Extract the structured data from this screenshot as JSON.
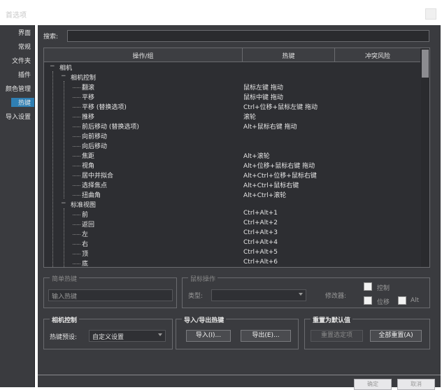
{
  "window": {
    "title": "首选项"
  },
  "sidebar": {
    "items": [
      "界面",
      "常规",
      "文件夹",
      "插件",
      "颜色管理",
      "热键",
      "导入设置"
    ],
    "selected_index": 5
  },
  "search": {
    "label": "搜索:",
    "value": ""
  },
  "table": {
    "headers": [
      "操作/组",
      "热键",
      "冲突风险"
    ],
    "rows": [
      {
        "depth": 0,
        "toggle": "−",
        "name": "相机",
        "key": ""
      },
      {
        "depth": 1,
        "toggle": "−",
        "name": "相机控制",
        "key": ""
      },
      {
        "depth": 2,
        "toggle": "",
        "name": "翻滚",
        "key": "鼠标左键 拖动"
      },
      {
        "depth": 2,
        "toggle": "",
        "name": "平移",
        "key": "鼠标中键 拖动"
      },
      {
        "depth": 2,
        "toggle": "",
        "name": "平移 (替换选项)",
        "key": "Ctrl+位移+鼠标左键 拖动"
      },
      {
        "depth": 2,
        "toggle": "",
        "name": "推移",
        "key": "滚轮"
      },
      {
        "depth": 2,
        "toggle": "",
        "name": "前后移动 (替换选项)",
        "key": "Alt+鼠标右键 拖动"
      },
      {
        "depth": 2,
        "toggle": "",
        "name": "向前移动",
        "key": ""
      },
      {
        "depth": 2,
        "toggle": "",
        "name": "向后移动",
        "key": ""
      },
      {
        "depth": 2,
        "toggle": "",
        "name": "焦距",
        "key": "Alt+滚轮"
      },
      {
        "depth": 2,
        "toggle": "",
        "name": "视角",
        "key": "Alt+位移+鼠标右键 拖动"
      },
      {
        "depth": 2,
        "toggle": "",
        "name": "居中并拟合",
        "key": "Alt+Ctrl+位移+鼠标右键"
      },
      {
        "depth": 2,
        "toggle": "",
        "name": "选择焦点",
        "key": "Alt+Ctrl+鼠标右键"
      },
      {
        "depth": 2,
        "toggle": "",
        "name": "扭曲角",
        "key": "Alt+Ctrl+滚轮"
      },
      {
        "depth": 1,
        "toggle": "−",
        "name": "标准视图",
        "key": ""
      },
      {
        "depth": 2,
        "toggle": "",
        "name": "前",
        "key": "Ctrl+Alt+1"
      },
      {
        "depth": 2,
        "toggle": "",
        "name": "返回",
        "key": "Ctrl+Alt+2"
      },
      {
        "depth": 2,
        "toggle": "",
        "name": "左",
        "key": "Ctrl+Alt+3"
      },
      {
        "depth": 2,
        "toggle": "",
        "name": "右",
        "key": "Ctrl+Alt+4"
      },
      {
        "depth": 2,
        "toggle": "",
        "name": "顶",
        "key": "Ctrl+Alt+5"
      },
      {
        "depth": 2,
        "toggle": "",
        "name": "底",
        "key": "Ctrl+Alt+6"
      }
    ]
  },
  "simple_hotkey": {
    "title": "简单热键",
    "placeholder": "输入热键"
  },
  "mouse_ops": {
    "title": "鼠标操作",
    "type_label": "类型:",
    "modifier_label": "修改器:",
    "ctrl_label": "控制",
    "shift_label": "位移",
    "alt_label": "Alt"
  },
  "camera_control": {
    "title": "相机控制",
    "preset_label": "热键预设:",
    "preset_value": "自定义设置"
  },
  "import_export": {
    "title": "导入/导出热键",
    "import_label": "导入(I)...",
    "export_label": "导出(E)..."
  },
  "reset": {
    "title": "重置为默认值",
    "reset_selected_label": "重置选定项",
    "reset_all_label": "全部重置(A)"
  },
  "footer": {
    "ok_label": "确定",
    "cancel_label": "取消"
  }
}
